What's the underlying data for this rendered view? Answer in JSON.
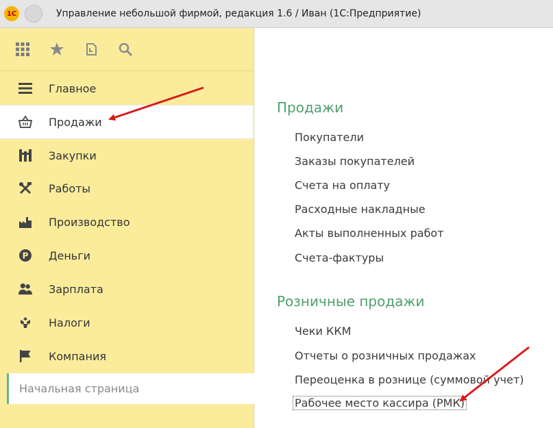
{
  "window": {
    "title": "Управление небольшой фирмой, редакция 1.6 / Иван  (1С:Предприятие)",
    "logo_text": "1С"
  },
  "toolbar": {
    "icons": [
      "apps-grid-icon",
      "star-icon",
      "history-icon",
      "search-icon"
    ]
  },
  "sidebar": {
    "items": [
      {
        "label": "Главное",
        "icon": "menu-lines-icon",
        "selected": false
      },
      {
        "label": "Продажи",
        "icon": "basket-icon",
        "selected": true
      },
      {
        "label": "Закупки",
        "icon": "cart-icon",
        "selected": false
      },
      {
        "label": "Работы",
        "icon": "tools-icon",
        "selected": false
      },
      {
        "label": "Производство",
        "icon": "factory-icon",
        "selected": false
      },
      {
        "label": "Деньги",
        "icon": "money-icon",
        "selected": false
      },
      {
        "label": "Зарплата",
        "icon": "people-icon",
        "selected": false
      },
      {
        "label": "Налоги",
        "icon": "emblem-icon",
        "selected": false
      },
      {
        "label": "Компания",
        "icon": "flag-icon",
        "selected": false
      }
    ],
    "start_page": "Начальная страница"
  },
  "content": {
    "sections": [
      {
        "title": "Продажи",
        "links": [
          "Покупатели",
          "Заказы покупателей",
          "Счета на оплату",
          "Расходные накладные",
          "Акты выполненных работ",
          "Счета-фактуры"
        ]
      },
      {
        "title": "Розничные продажи",
        "links": [
          "Чеки ККМ",
          "Отчеты о розничных продажах",
          "Переоценка в рознице (суммовой учет)",
          "Рабочее место кассира (РМК)"
        ]
      }
    ]
  },
  "colors": {
    "sidebar_bg": "#fbec9c",
    "section_title": "#4f9f6b",
    "arrow": "#d81a1a"
  }
}
